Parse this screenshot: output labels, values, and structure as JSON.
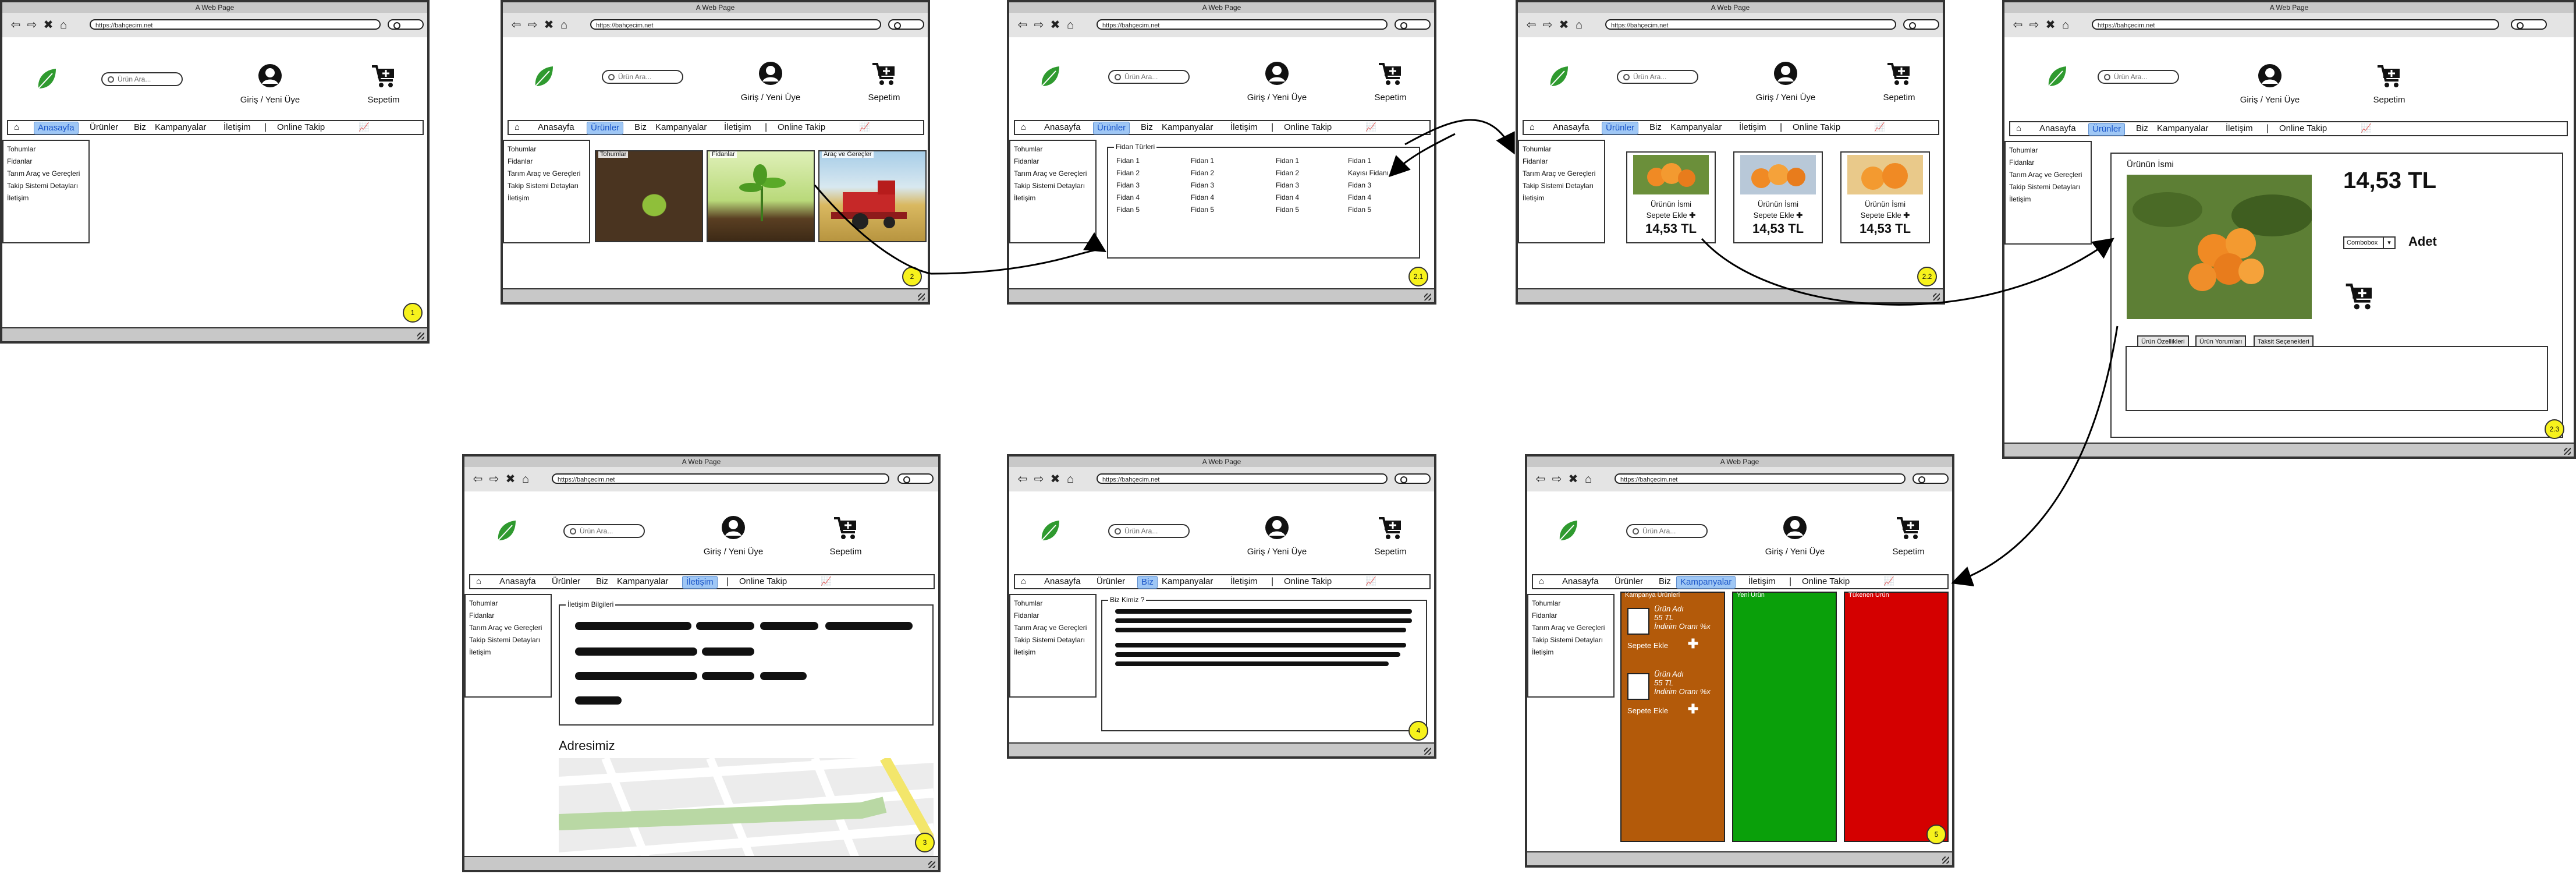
{
  "browser": {
    "title": "A Web Page",
    "url": "https://bahçecim.net"
  },
  "site": {
    "search_placeholder": "Ürün Ara...",
    "user_label": "Giriş / Yeni Üye",
    "cart_label": "Sepetim"
  },
  "menu": [
    "Anasayfa",
    "Ürünler",
    "Biz",
    "Kampanyalar",
    "İletişim",
    "Online Takip"
  ],
  "sidebar": [
    "Tohumlar",
    "Fidanlar",
    "Tarım Araç ve Gereçleri",
    "Takip Sistemi Detayları",
    "İletişim"
  ],
  "products_page": {
    "captions": [
      "Tohumlar",
      "Fidanlar",
      "Araç ve Gereçler"
    ]
  },
  "fidan_page": {
    "title": "Fidan Türleri",
    "columns": [
      [
        "Fidan 1",
        "Fidan 2",
        "Fidan 3",
        "Fidan 4",
        "Fidan 5"
      ],
      [
        "Fidan 1",
        "Fidan 2",
        "Fidan 3",
        "Fidan 4",
        "Fidan 5"
      ],
      [
        "Fidan 1",
        "Fidan 2",
        "Fidan 3",
        "Fidan 4",
        "Fidan 5"
      ],
      [
        "Fidan 1",
        "Kayısı Fidanı",
        "Fidan 3",
        "Fidan 4",
        "Fidan 5"
      ]
    ]
  },
  "product_cards": {
    "name": "Ürünün İsmi",
    "add": "Sepete Ekle",
    "price": "14,53 TL"
  },
  "product_detail": {
    "name": "Ürünün İsmi",
    "price": "14,53 TL",
    "combo": "Combobox",
    "unit": "Adet",
    "tabs": [
      "Ürün Özellikleri",
      "Ürün Yorumları",
      "Taksit Seçenekleri"
    ]
  },
  "contact_page": {
    "panel_title": "İletişim Bilgileri",
    "address_title": "Adresimiz"
  },
  "about_page": {
    "panel_title": "Biz Kimiz ?"
  },
  "campaign_page": {
    "columns": [
      "Kampanya Ürünleri",
      "Yeni Ürün",
      "Tükenen Ürün"
    ],
    "item_lines": [
      "Ürün Adı",
      "55 TL",
      "İndirim Oranı %x"
    ],
    "add": "Sepete Ekle"
  },
  "badges": [
    "1",
    "2",
    "2.1",
    "2.2",
    "2.3",
    "3",
    "4",
    "5"
  ],
  "colors": {
    "active_menu": "#9fc7f5",
    "leaf": "#2f9a2f",
    "campaign": "#b35a0a",
    "new": "#0aa00a",
    "soldout": "#d40000",
    "badge": "#f7f21c"
  }
}
